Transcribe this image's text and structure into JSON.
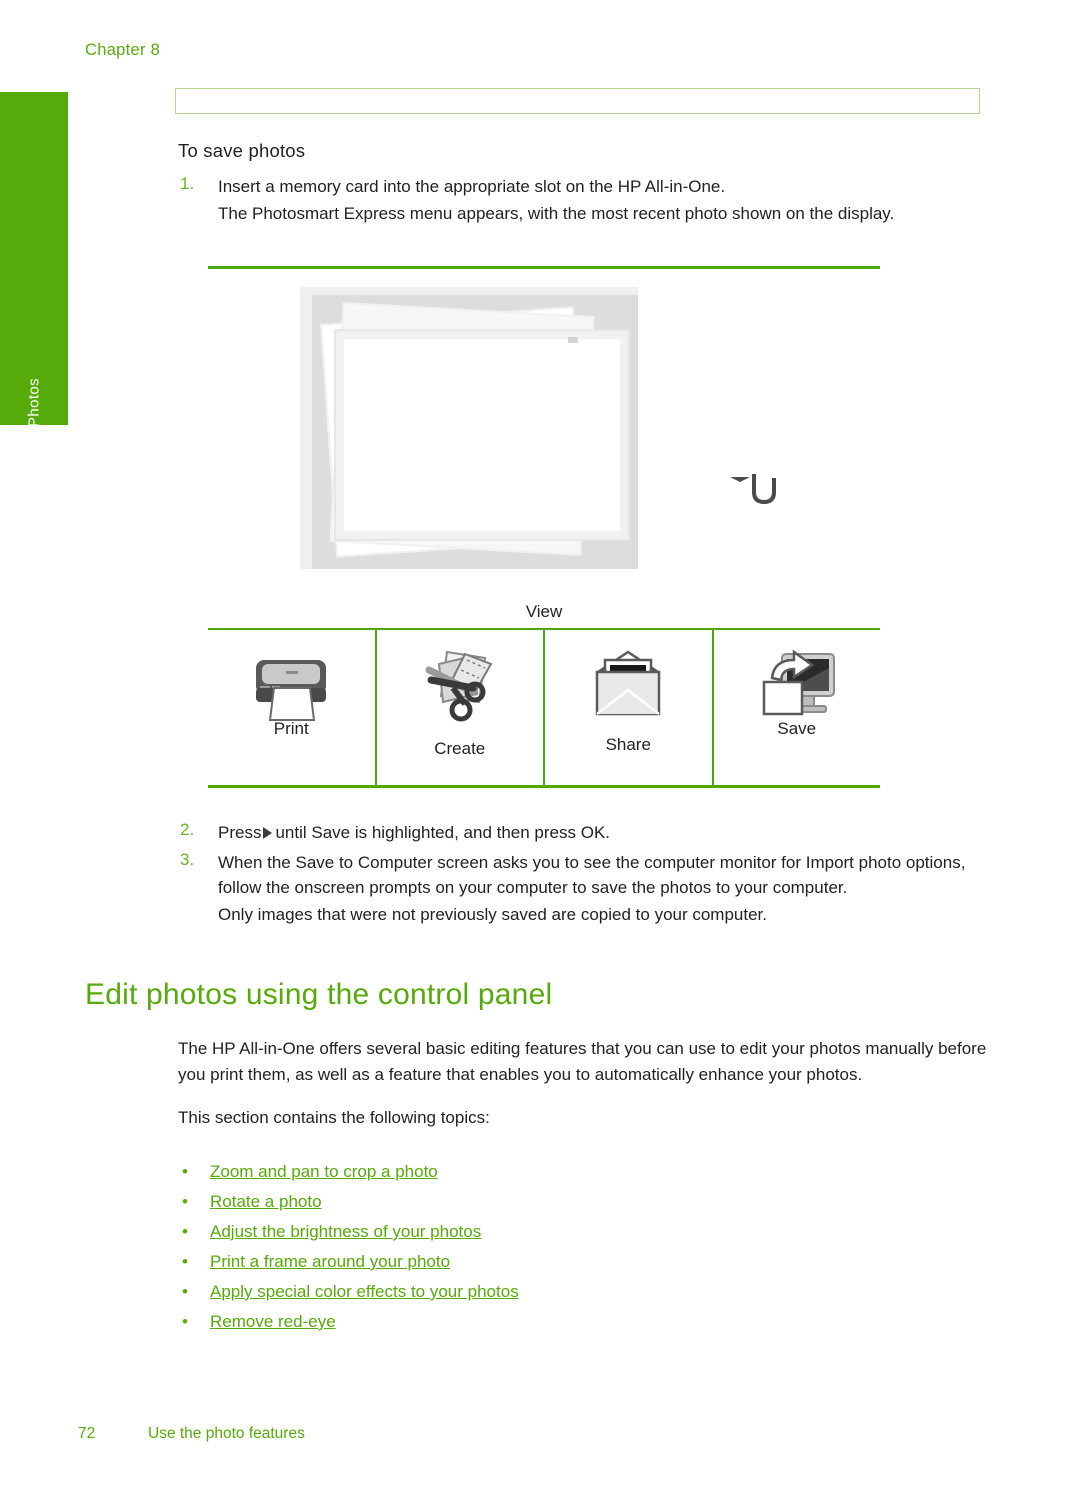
{
  "header": {
    "chapter_label": "Chapter 8",
    "running_head_box": ""
  },
  "side_tab": {
    "label": "Photos",
    "color": "#56ab0a"
  },
  "colors": {
    "brand_green": "#56ab0a",
    "rule_green": "#4fa80a",
    "box_border_green": "#b4d98c",
    "body_text": "#231f20"
  },
  "procedure": {
    "heading": "To save photos",
    "steps": [
      {
        "number": "1.",
        "lines": [
          "Insert a memory card into the appropriate slot on the HP All-in-One.",
          "The Photosmart Express menu appears, with the most recent photo shown on the display."
        ]
      }
    ]
  },
  "figure": {
    "display_caption": "",
    "menu": {
      "view_label": "View",
      "items": [
        {
          "label": "Print",
          "icon": "printer-icon"
        },
        {
          "label": "Create",
          "icon": "scissors-crafts-icon"
        },
        {
          "label": "Share",
          "icon": "envelope-icon"
        },
        {
          "label": "Save",
          "icon": "monitor-save-icon"
        }
      ]
    },
    "pointer_icon": "curved-hook-arrow-icon"
  },
  "post_steps": [
    {
      "number": "2.",
      "text_before_arrow": "Press",
      "arrow_glyph": "right-triangle-icon",
      "text_after_arrow": "until Save is highlighted, and then press OK."
    },
    {
      "number": "3.",
      "lines": [
        "When the Save to Computer screen asks you to see the computer monitor for Import photo options, follow the onscreen prompts on your computer to save the photos to your computer.",
        "Only images that were not previously saved are copied to your computer."
      ]
    }
  ],
  "section": {
    "title": "Edit photos using the control panel",
    "paragraphs": [
      "The HP All-in-One offers several basic editing features that you can use to edit your photos manually before you print them, as well as a feature that enables you to automatically enhance your photos.",
      "This section contains the following topics:"
    ],
    "topics": [
      "Zoom and pan to crop a photo",
      "Rotate a photo",
      "Adjust the brightness of your photos",
      "Print a frame around your photo",
      "Apply special color effects to your photos",
      "Remove red-eye"
    ],
    "bullet_glyph": "•"
  },
  "footer": {
    "page_number": "72",
    "section_name": "Use the photo features"
  }
}
